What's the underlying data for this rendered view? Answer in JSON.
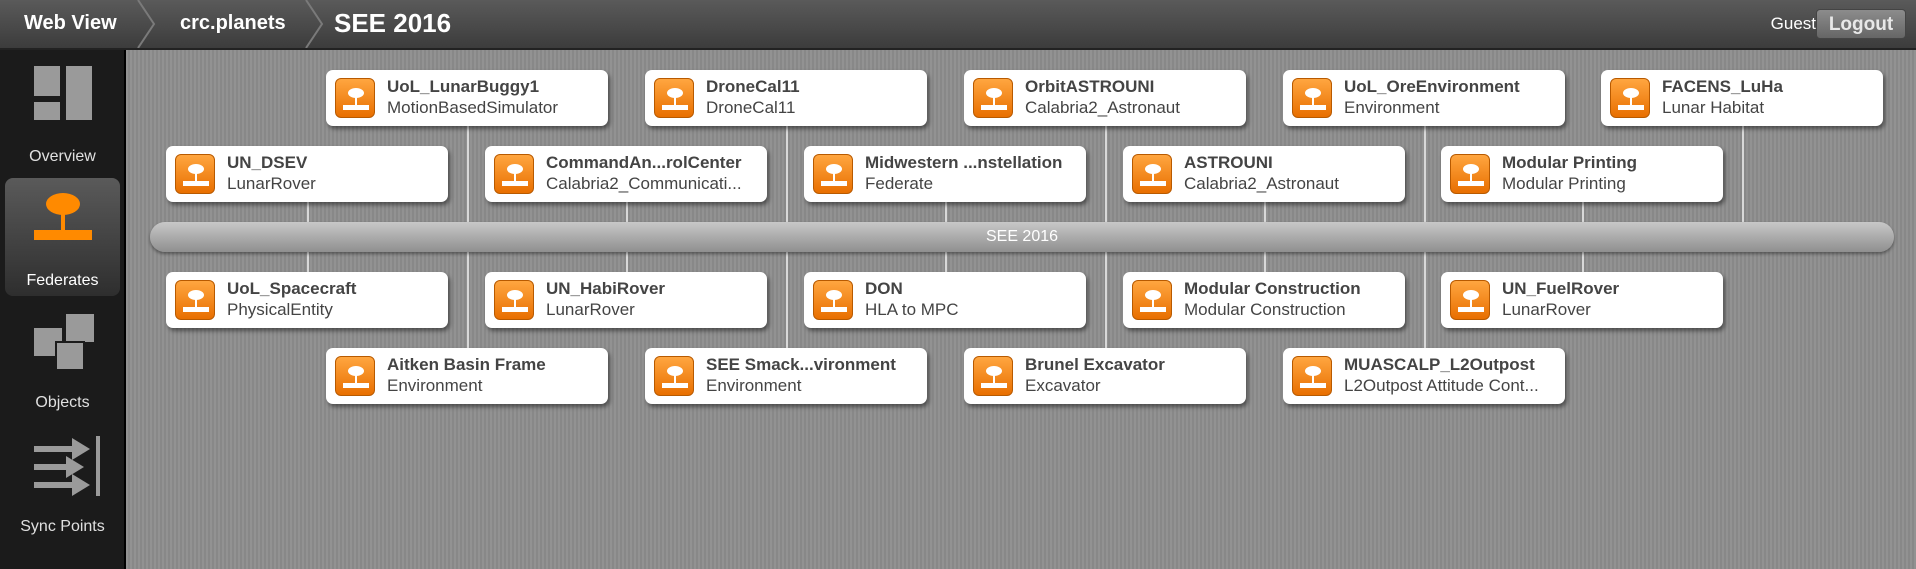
{
  "header": {
    "crumbs": [
      "Web View",
      "crc.planets",
      "SEE 2016"
    ],
    "user": "Guest",
    "logout_label": "Logout"
  },
  "sidebar": {
    "items": [
      {
        "label": "Overview",
        "icon": "overview-icon"
      },
      {
        "label": "Federates",
        "icon": "federates-icon",
        "active": true
      },
      {
        "label": "Objects",
        "icon": "objects-icon"
      },
      {
        "label": "Sync Points",
        "icon": "sync-points-icon"
      }
    ]
  },
  "federation": {
    "name": "SEE 2016",
    "top_row_back": [
      {
        "name": "UoL_LunarBuggy1",
        "type": "MotionBasedSimulator"
      },
      {
        "name": "DroneCal11",
        "type": "DroneCal11"
      },
      {
        "name": "OrbitASTROUNI",
        "type": "Calabria2_Astronaut"
      },
      {
        "name": "UoL_OreEnvironment",
        "type": "Environment"
      },
      {
        "name": "FACENS_LuHa",
        "type": "Lunar Habitat"
      }
    ],
    "top_row_front": [
      {
        "name": "UN_DSEV",
        "type": "LunarRover"
      },
      {
        "name": "CommandAn...rolCenter",
        "type": "Calabria2_Communicati..."
      },
      {
        "name": "Midwestern ...nstellation",
        "type": "Federate"
      },
      {
        "name": "ASTROUNI",
        "type": "Calabria2_Astronaut"
      },
      {
        "name": "Modular Printing",
        "type": "Modular Printing"
      }
    ],
    "bottom_row_front": [
      {
        "name": "UoL_Spacecraft",
        "type": "PhysicalEntity"
      },
      {
        "name": "UN_HabiRover",
        "type": "LunarRover"
      },
      {
        "name": "DON",
        "type": "HLA to MPC"
      },
      {
        "name": "Modular Construction",
        "type": "Modular Construction"
      },
      {
        "name": "UN_FuelRover",
        "type": "LunarRover"
      }
    ],
    "bottom_row_back": [
      {
        "name": "Aitken Basin Frame",
        "type": "Environment"
      },
      {
        "name": "SEE Smack...vironment",
        "type": "Environment"
      },
      {
        "name": "Brunel Excavator",
        "type": "Excavator"
      },
      {
        "name": "MUASCALP_L2Outpost",
        "type": "L2Outpost Attitude Cont..."
      }
    ]
  }
}
